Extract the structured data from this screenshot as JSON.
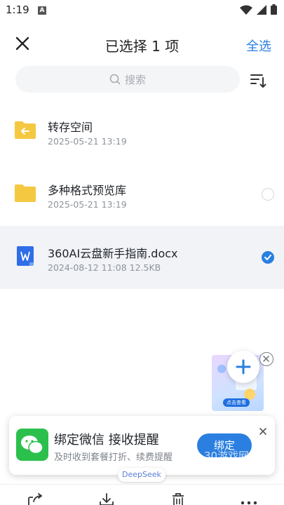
{
  "status_bar": {
    "time": "1:19",
    "notification_glyph": "A"
  },
  "header": {
    "title": "已选择 1 项",
    "select_all_label": "全选"
  },
  "search": {
    "placeholder": "搜索"
  },
  "files": [
    {
      "name": "转存空间",
      "meta": "2025-05-21 13:19",
      "icon": "transfer-folder-icon",
      "selected": false,
      "show_check": false
    },
    {
      "name": "多种格式预览库",
      "meta": "2025-05-21 13:19",
      "icon": "folder-icon",
      "selected": false,
      "show_check": true
    },
    {
      "name": "360AI云盘新手指南.docx",
      "meta": "2024-08-12 11:08   12.5KB",
      "icon": "word-doc-icon",
      "selected": true,
      "show_check": true
    }
  ],
  "promo": {
    "button_text": "点击查看"
  },
  "banner": {
    "title": "绑定微信 接收提醒",
    "subtitle": "及时收到套餐打折、续费提醒",
    "button_label": "绑定",
    "watermark": "30游戏网"
  },
  "deepseek_tag": "DeepSeek",
  "colors": {
    "accent": "#2a7fe0",
    "folder": "#f5c842",
    "wechat_green": "#2bc04c"
  },
  "toolbar": {
    "items": [
      "share-icon",
      "download-icon",
      "delete-icon",
      "more-icon"
    ]
  }
}
